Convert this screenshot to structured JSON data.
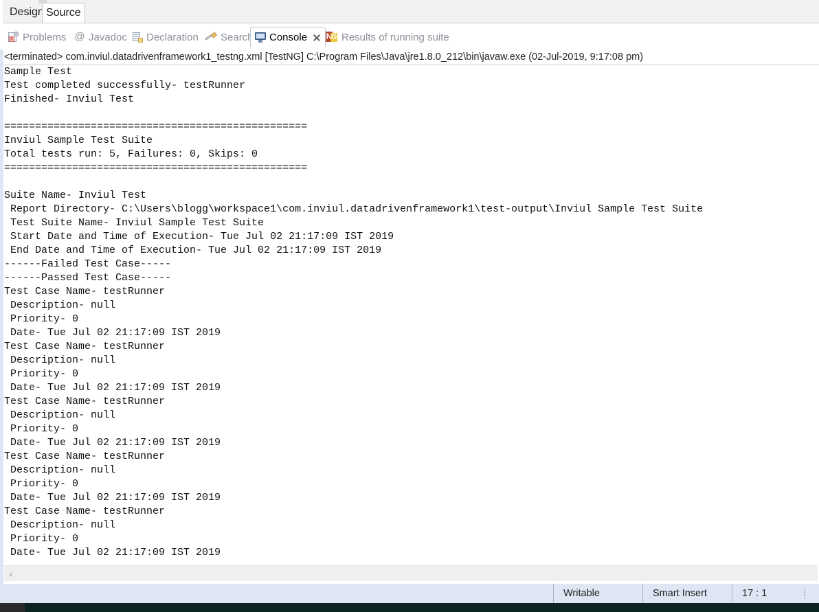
{
  "editor_tabs": [
    {
      "label": "Design",
      "active": false
    },
    {
      "label": "Source",
      "active": true
    }
  ],
  "view_tabs": [
    {
      "label": "Problems",
      "icon": "problems-icon",
      "active": false
    },
    {
      "label": "Javadoc",
      "icon": "javadoc-at-icon",
      "active": false
    },
    {
      "label": "Declaration",
      "icon": "declaration-icon",
      "active": false
    },
    {
      "label": "Search",
      "icon": "search-icon",
      "active": false
    },
    {
      "label": "Console",
      "icon": "console-icon",
      "active": true,
      "closable": true
    },
    {
      "label": "Results of running suite",
      "icon": "testng-icon",
      "active": false
    }
  ],
  "view_toolbar": [
    {
      "name": "terminate-button",
      "icon": "stop-square-icon"
    },
    {
      "name": "remove-launch-button",
      "icon": "close-x-icon"
    },
    {
      "name": "remove-all-terminated-button",
      "icon": "close-all-x-icon"
    },
    {
      "name": "clear-console-button",
      "icon": "clear-console-icon"
    },
    {
      "name": "scroll-lock-button",
      "icon": "lock-icon",
      "toggled": true
    }
  ],
  "console": {
    "header": "<terminated> com.inviul.datadrivenframework1_testng.xml [TestNG] C:\\Program Files\\Java\\jre1.8.0_212\\bin\\javaw.exe (02-Jul-2019, 9:17:08 pm)",
    "lines": [
      "Sample Test",
      "Test completed successfully- testRunner",
      "Finished- Inviul Test",
      "",
      "=================================================",
      "Inviul Sample Test Suite",
      "Total tests run: 5, Failures: 0, Skips: 0",
      "=================================================",
      "",
      "Suite Name- Inviul Test",
      " Report Directory- C:\\Users\\blogg\\workspace1\\com.inviul.datadrivenframework1\\test-output\\Inviul Sample Test Suite",
      " Test Suite Name- Inviul Sample Test Suite",
      " Start Date and Time of Execution- Tue Jul 02 21:17:09 IST 2019",
      " End Date and Time of Execution- Tue Jul 02 21:17:09 IST 2019",
      "------Failed Test Case-----",
      "------Passed Test Case-----",
      "Test Case Name- testRunner",
      " Description- null",
      " Priority- 0",
      " Date- Tue Jul 02 21:17:09 IST 2019",
      "Test Case Name- testRunner",
      " Description- null",
      " Priority- 0",
      " Date- Tue Jul 02 21:17:09 IST 2019",
      "Test Case Name- testRunner",
      " Description- null",
      " Priority- 0",
      " Date- Tue Jul 02 21:17:09 IST 2019",
      "Test Case Name- testRunner",
      " Description- null",
      " Priority- 0",
      " Date- Tue Jul 02 21:17:09 IST 2019",
      "Test Case Name- testRunner",
      " Description- null",
      " Priority- 0",
      " Date- Tue Jul 02 21:17:09 IST 2019"
    ],
    "scroll_left_arrow": "‹"
  },
  "statusbar": {
    "writable": "Writable",
    "insert_mode": "Smart Insert",
    "position": "17 : 1"
  },
  "colors": {
    "status_bg": "#dfe5f3",
    "console_bg": "#ffffff",
    "tab_active_border": "#bcc6d6",
    "inactive_tab_text": "#8d9099",
    "bottom_strip": "#0c2420"
  }
}
